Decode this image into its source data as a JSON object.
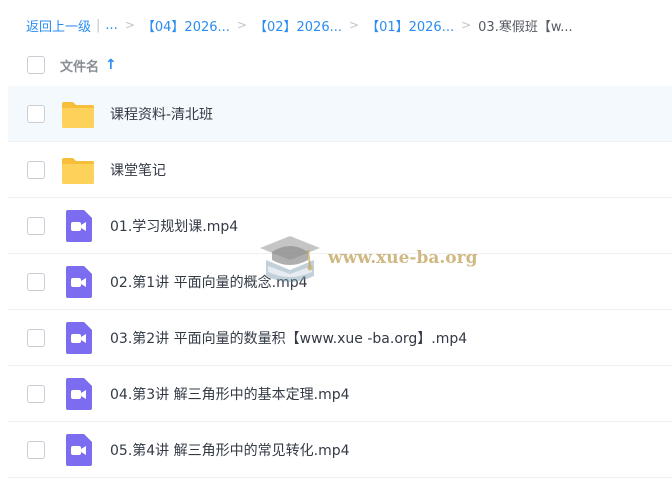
{
  "breadcrumb": {
    "back": "返回上一级",
    "separator_bar": "|",
    "ellipsis": "...",
    "arrow": ">",
    "items": [
      "【04】2026...",
      "【02】2026...",
      "【01】2026..."
    ],
    "current": "03.寒假班【w..."
  },
  "header": {
    "name_label": "文件名",
    "sort_arrow": "↑"
  },
  "files": [
    {
      "name": "课程资料-清北班",
      "type": "folder"
    },
    {
      "name": "课堂笔记",
      "type": "folder"
    },
    {
      "name": "01.学习规划课.mp4",
      "type": "video"
    },
    {
      "name": "02.第1讲 平面向量的概念.mp4",
      "type": "video"
    },
    {
      "name": "03.第2讲 平面向量的数量积【www.xue -ba.org】.mp4",
      "type": "video"
    },
    {
      "name": "04.第3讲 解三角形中的基本定理.mp4",
      "type": "video"
    },
    {
      "name": "05.第4讲 解三角形中的常见转化.mp4",
      "type": "video"
    }
  ],
  "watermark": {
    "text": "www.xue-ba.org",
    "icon": "graduation-cap-icon"
  },
  "colors": {
    "accent": "#2a8df3",
    "folder": "#f9c94a",
    "video": "#7b6cf0",
    "selected_row": "#f3f9fd"
  }
}
